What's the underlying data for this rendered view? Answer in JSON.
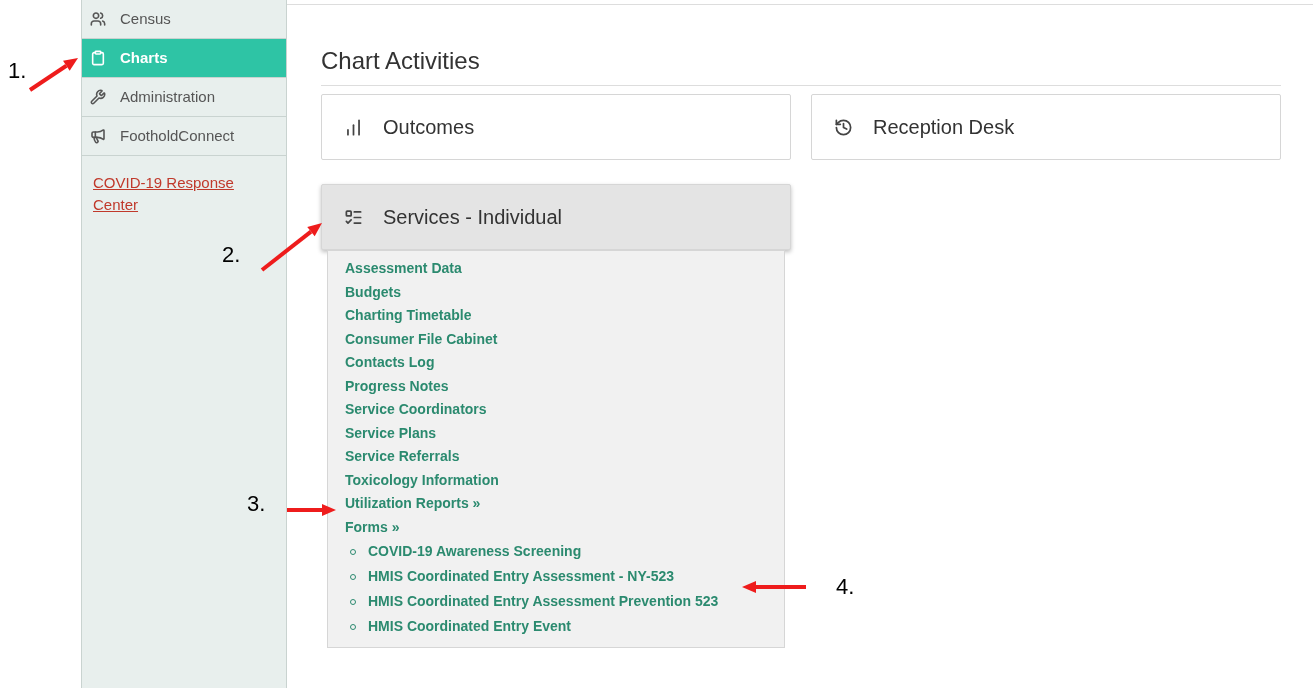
{
  "sidebar": {
    "items": [
      {
        "label": "Census",
        "kind": "people",
        "selected": false
      },
      {
        "label": "Charts",
        "kind": "clipboard",
        "selected": true
      },
      {
        "label": "Administration",
        "kind": "wrench",
        "selected": false
      },
      {
        "label": "FootholdConnect",
        "kind": "megaphone",
        "selected": false
      }
    ],
    "link": "COVID-19 Response Center"
  },
  "page_title": "Chart Activities",
  "cards": [
    {
      "label": "Outcomes",
      "kind": "chart",
      "expanded": false
    },
    {
      "label": "Reception Desk",
      "kind": "history",
      "expanded": false
    },
    {
      "label": "Services - Individual",
      "kind": "list",
      "expanded": true,
      "items": [
        {
          "label": "Assessment Data"
        },
        {
          "label": "Budgets"
        },
        {
          "label": "Charting Timetable"
        },
        {
          "label": "Consumer File Cabinet"
        },
        {
          "label": "Contacts Log"
        },
        {
          "label": "Progress Notes"
        },
        {
          "label": "Service Coordinators"
        },
        {
          "label": "Service Plans"
        },
        {
          "label": "Service Referrals"
        },
        {
          "label": "Toxicology Information"
        },
        {
          "label": "Utilization Reports »"
        },
        {
          "label": "Forms »",
          "children": [
            {
              "label": "COVID-19 Awareness Screening"
            },
            {
              "label": "HMIS Coordinated Entry Assessment - NY-523"
            },
            {
              "label": "HMIS Coordinated Entry Assessment Prevention 523"
            },
            {
              "label": "HMIS Coordinated Entry Event"
            }
          ]
        }
      ]
    }
  ],
  "annotations": [
    {
      "label": "1."
    },
    {
      "label": "2."
    },
    {
      "label": "3."
    },
    {
      "label": "4."
    }
  ]
}
